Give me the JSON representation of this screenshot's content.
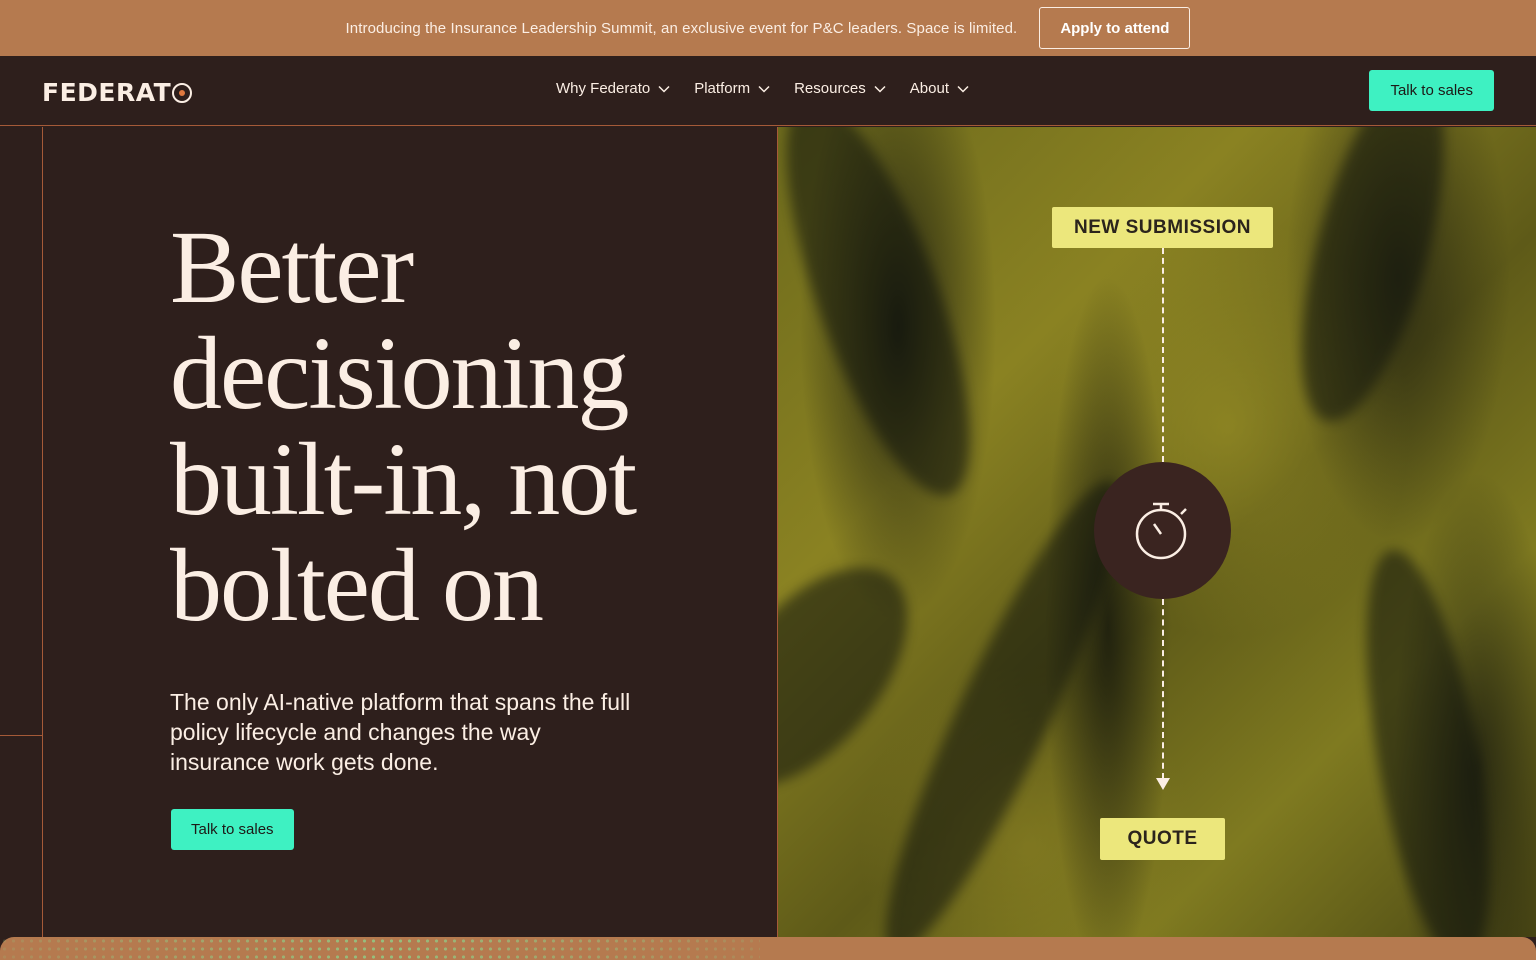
{
  "announcement": {
    "text": "Introducing the Insurance Leadership Summit, an exclusive event for P&C leaders. Space is limited.",
    "button": "Apply to attend"
  },
  "nav": {
    "logo": "FEDERAT",
    "items": [
      {
        "label": "Why Federato",
        "icon": "chevron-down-icon"
      },
      {
        "label": "Platform",
        "icon": "chevron-down-icon"
      },
      {
        "label": "Resources",
        "icon": "chevron-down-icon"
      },
      {
        "label": "About",
        "icon": "chevron-down-icon"
      }
    ],
    "cta": "Talk to sales"
  },
  "hero": {
    "headline_lines": [
      "Better",
      "decisioning",
      "built-in, not",
      "bolted on"
    ],
    "subhead": "The only AI-native platform that spans the full policy lifecycle and changes the way insurance work gets done.",
    "cta": "Talk to sales"
  },
  "graphic": {
    "top_tag": "NEW SUBMISSION",
    "bottom_tag": "QUOTE",
    "center_icon": "stopwatch-icon"
  },
  "colors": {
    "background": "#2e1f1c",
    "accent_mint": "#3ef1c2",
    "announce_bg": "#b57a4f",
    "tag_yellow": "#ece77c",
    "rule_line": "#a55a38"
  }
}
